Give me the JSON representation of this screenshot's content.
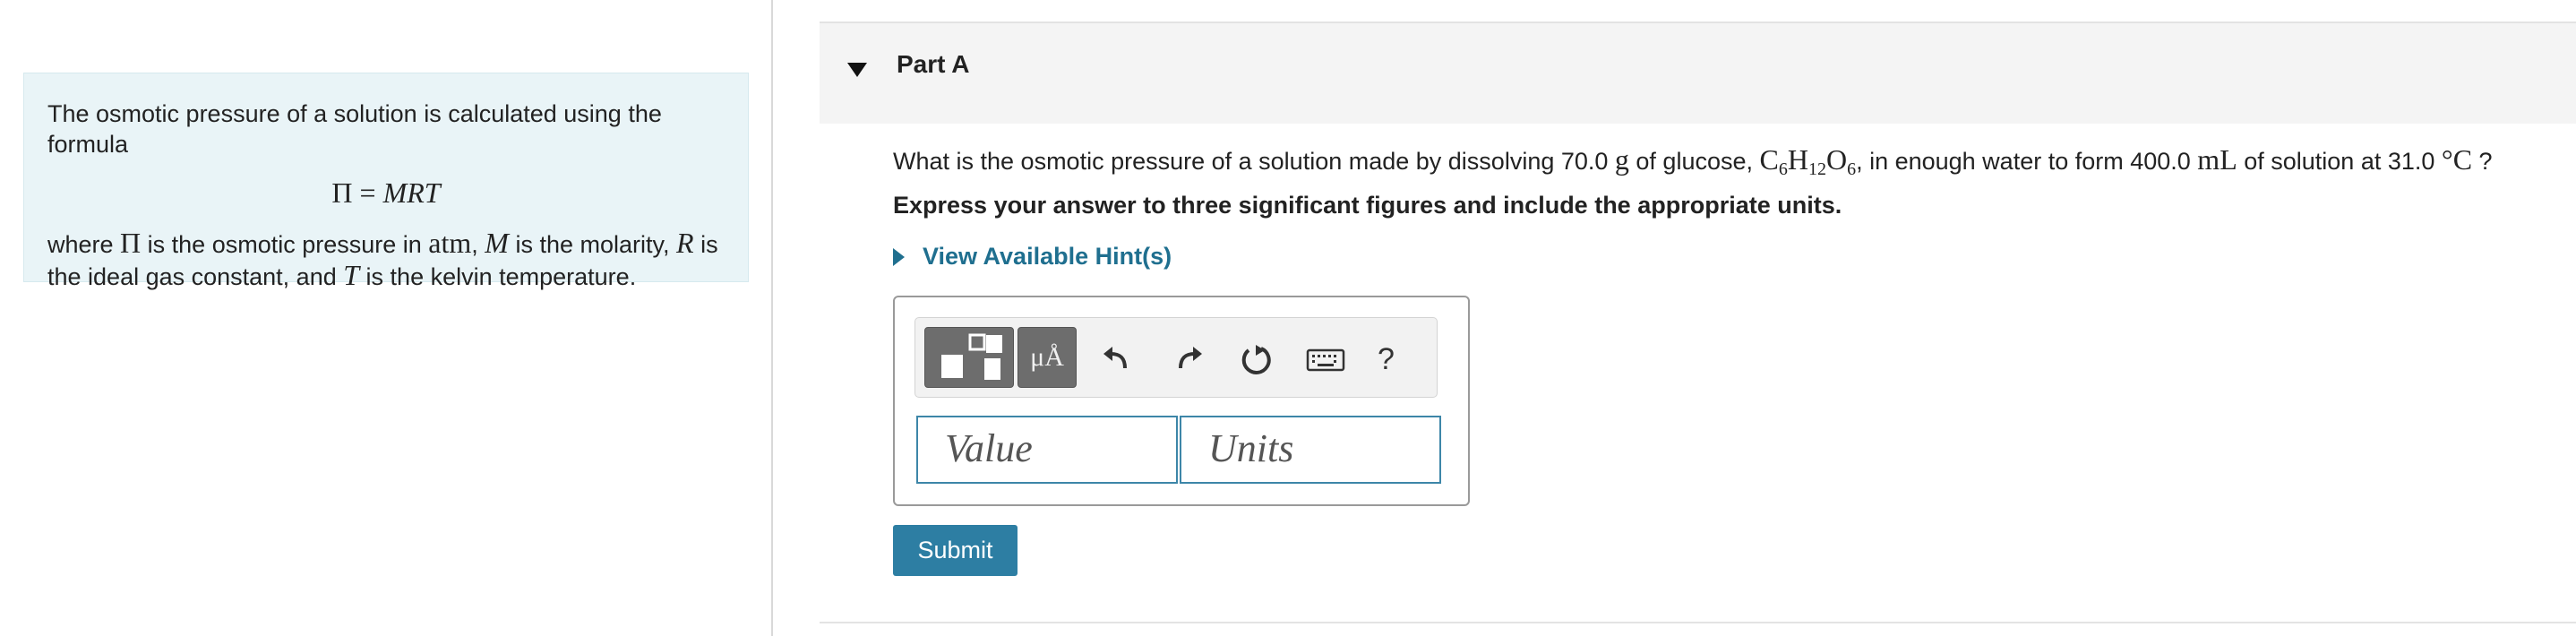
{
  "info_panel": {
    "intro": "The osmotic pressure of a solution is calculated using the formula",
    "formula": {
      "lhs": "Π",
      "eq": " = ",
      "rhs": "MRT"
    },
    "where": {
      "t1": "where ",
      "pi": "Π",
      "t2": " is the osmotic pressure in ",
      "atm": "atm",
      "t3": ", ",
      "m": "M",
      "t4": " is the molarity, ",
      "r": "R",
      "t5": " is the ideal gas constant, and ",
      "t": "T",
      "t6": " is the kelvin temperature."
    }
  },
  "part": {
    "title": "Part A",
    "toggle_icon": "caret-down-icon"
  },
  "question": {
    "t1": "What is the osmotic pressure of a solution made by dissolving 70.0 ",
    "g": "g",
    "t2": " of glucose, ",
    "c": "C",
    "c_sub": "6",
    "h": "H",
    "h_sub": "12",
    "o": "O",
    "o_sub": "6",
    "t3": ", in enough water to form 400.0 ",
    "ml": "mL",
    "t4": " of solution at 31.0 ",
    "deg": "°C",
    "t5": " ?"
  },
  "instruction": "Express your answer to three significant figures and include the appropriate units.",
  "hints_link": "View Available Hint(s)",
  "toolbar": {
    "template_icon": "templates-icon",
    "units_symbol": "μÅ",
    "undo_icon": "undo-icon",
    "redo_icon": "redo-icon",
    "reset_icon": "reset-icon",
    "keyboard_icon": "keyboard-icon",
    "help_label": "?"
  },
  "inputs": {
    "value_placeholder": "Value",
    "units_placeholder": "Units"
  },
  "submit_label": "Submit",
  "colors": {
    "accent": "#2d7ea3",
    "link": "#1f6f8f",
    "panel_bg": "#e9f4f7",
    "header_bg": "#f4f4f4"
  }
}
